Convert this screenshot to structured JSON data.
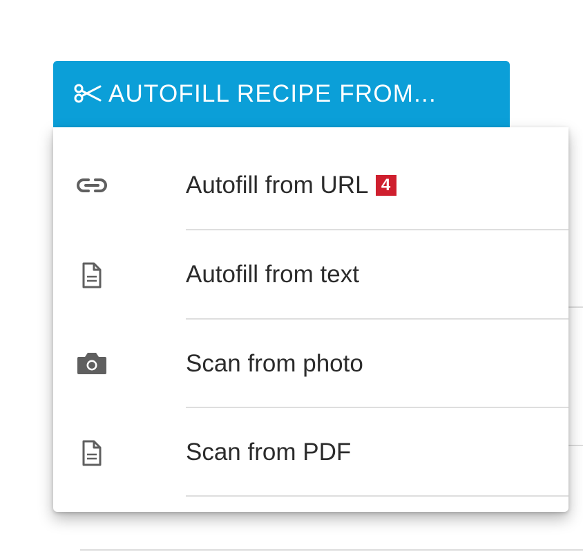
{
  "button": {
    "icon": "scissors-icon",
    "label": "AUTOFILL RECIPE FROM...",
    "color": "#0b9fd8"
  },
  "menu": {
    "items": [
      {
        "icon": "link-icon",
        "label": "Autofill from URL",
        "badge": "4"
      },
      {
        "icon": "document-icon",
        "label": "Autofill from text"
      },
      {
        "icon": "camera-icon",
        "label": "Scan from photo"
      },
      {
        "icon": "document-icon",
        "label": "Scan from PDF"
      }
    ]
  },
  "badge_color": "#cf1f2e"
}
